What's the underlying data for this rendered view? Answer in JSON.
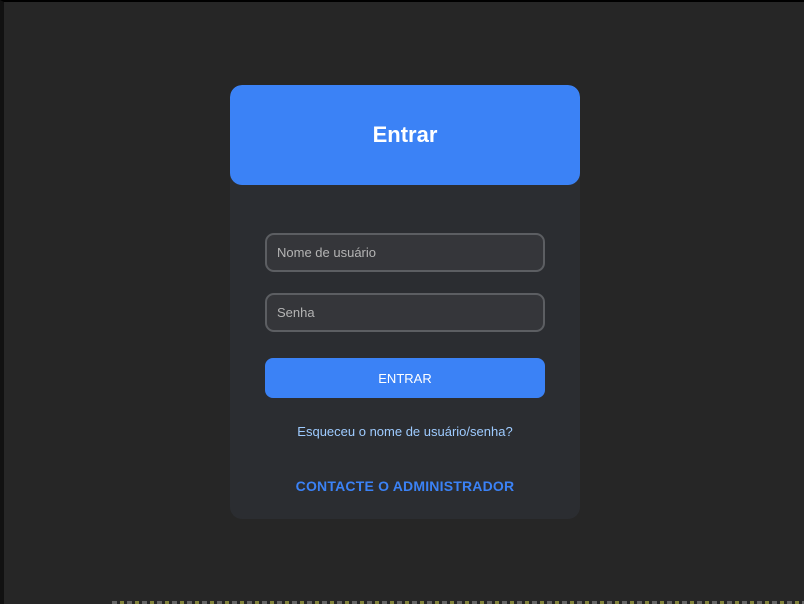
{
  "login": {
    "title": "Entrar",
    "username_placeholder": "Nome de usuário",
    "password_placeholder": "Senha",
    "submit_label": "ENTRAR",
    "forgot_link": "Esqueceu o nome de usuário/senha?",
    "contact_admin": "CONTACTE O ADMINISTRADOR"
  },
  "colors": {
    "accent": "#3b82f6",
    "card_background": "#2b2d31",
    "page_background": "#262626",
    "link_light": "#9ecbff"
  }
}
